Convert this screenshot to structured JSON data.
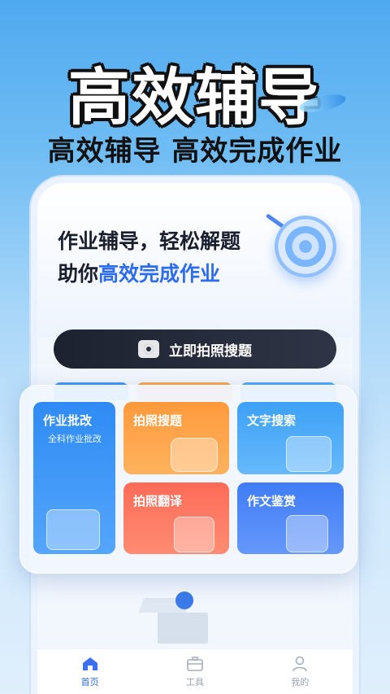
{
  "hero": {
    "title": "高效辅导",
    "subtitle": "高效辅导 高效完成作业"
  },
  "app": {
    "slogan_line1": "作业辅导，轻松解题",
    "slogan_line2_prefix": "助你",
    "slogan_line2_highlight": "高效完成作业",
    "scan_button_label": "立即拍照搜题"
  },
  "features": [
    {
      "label": "作业批改",
      "sublabel": "全科作业批改"
    },
    {
      "label": "拍照搜题"
    },
    {
      "label": "文字搜索"
    },
    {
      "label": "拍照翻译"
    },
    {
      "label": "作文鉴赏"
    }
  ],
  "tabs": [
    {
      "label": "首页",
      "icon": "home-icon",
      "active": true
    },
    {
      "label": "工具",
      "icon": "toolbox-icon",
      "active": false
    },
    {
      "label": "我的",
      "icon": "profile-icon",
      "active": false
    }
  ],
  "colors": {
    "accent": "#2d6cf0",
    "tile_blue": "#2f8bf4",
    "tile_orange": "#ff9a3c",
    "tile_red": "#ff6b57"
  }
}
